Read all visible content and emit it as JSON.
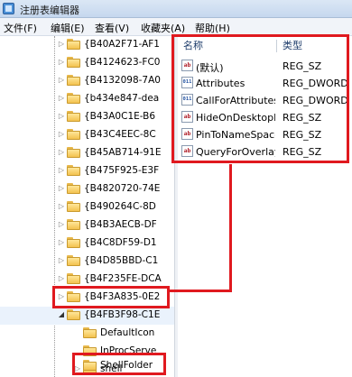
{
  "window": {
    "title": "注册表编辑器"
  },
  "menu": [
    "文件(F)",
    "编辑(E)",
    "查看(V)",
    "收藏夹(A)",
    "帮助(H)"
  ],
  "tree": {
    "items": [
      "{B40A2F71-AF1",
      "{B4124623-FC0",
      "{B4132098-7A0",
      "{b434e847-dea",
      "{B43A0C1E-B6",
      "{B43C4EEC-8C",
      "{B45AB714-91E",
      "{B475F925-E3F",
      "{B4820720-74E",
      "{B490264C-8D",
      "{B4B3AECB-DF",
      "{B4C8DF59-D1",
      "{B4D85BBD-C1",
      "{B4F235FE-DCA",
      "{B4F3A835-0E2",
      "{B4FB3F98-C1E"
    ],
    "children": [
      "DefaultIcon",
      "InProcServe",
      "shell",
      "ShellFolder"
    ]
  },
  "values": {
    "columns": {
      "name": "名称",
      "type": "类型"
    },
    "rows": [
      {
        "icon": "string-value-icon",
        "icon_text": "ab",
        "name": "(默认)",
        "type": "REG_SZ"
      },
      {
        "icon": "binary-value-icon",
        "icon_text": "011",
        "name": "Attributes",
        "type": "REG_DWORD"
      },
      {
        "icon": "binary-value-icon",
        "icon_text": "011",
        "name": "CallForAttributes",
        "type": "REG_DWORD"
      },
      {
        "icon": "string-value-icon",
        "icon_text": "ab",
        "name": "HideOnDesktopPerUser",
        "type": "REG_SZ"
      },
      {
        "icon": "string-value-icon",
        "icon_text": "ab",
        "name": "PinToNameSpaceTree",
        "type": "REG_SZ"
      },
      {
        "icon": "string-value-icon",
        "icon_text": "ab",
        "name": "QueryForOverlay",
        "type": "REG_SZ"
      }
    ]
  },
  "colors": {
    "highlight": "#e0191f",
    "menubar": "#f1f4f9",
    "folder": "#f3c24f"
  }
}
